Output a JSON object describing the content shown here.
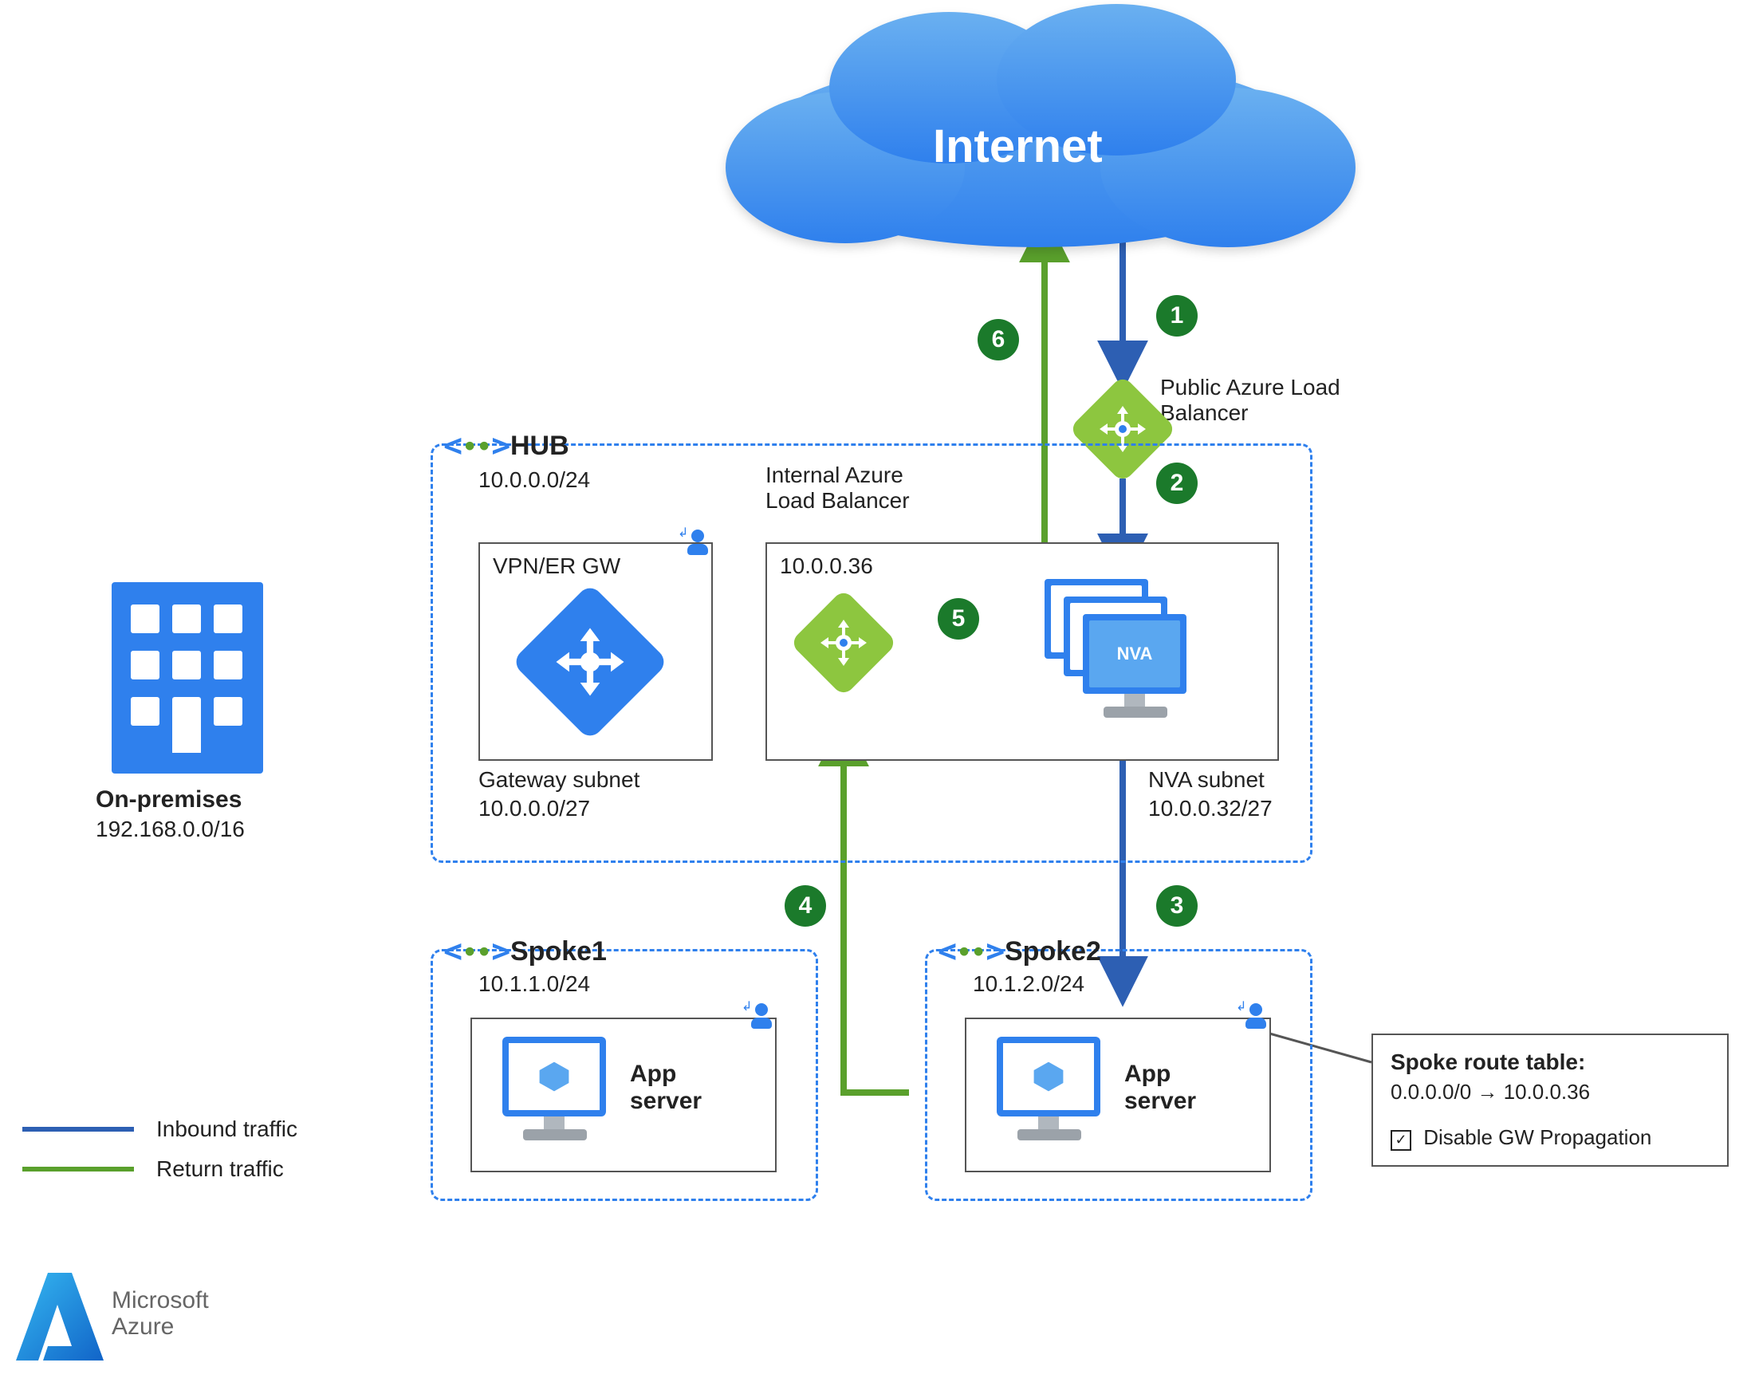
{
  "internet": {
    "label": "Internet"
  },
  "publicLB": {
    "label1": "Public Azure Load",
    "label2": "Balancer"
  },
  "internalLB": {
    "label1": "Internal Azure",
    "label2": "Load Balancer",
    "ip": "10.0.0.36"
  },
  "hub": {
    "title": "HUB",
    "cidr": "10.0.0.0/24",
    "gateway": {
      "title": "VPN/ER GW",
      "subnetLabel": "Gateway subnet",
      "subnetCidr": "10.0.0.0/27"
    },
    "nva": {
      "label": "NVA",
      "subnetLabel": "NVA subnet",
      "subnetCidr": "10.0.0.32/27"
    }
  },
  "spoke1": {
    "title": "Spoke1",
    "cidr": "10.1.1.0/24",
    "app": {
      "label1": "App",
      "label2": "server"
    }
  },
  "spoke2": {
    "title": "Spoke2",
    "cidr": "10.1.2.0/24",
    "app": {
      "label1": "App",
      "label2": "server"
    }
  },
  "onprem": {
    "title": "On-premises",
    "cidr": "192.168.0.0/16"
  },
  "routeTable": {
    "title": "Spoke route table:",
    "rule": "0.0.0.0/0  →   10.0.0.36",
    "checkbox": "Disable GW Propagation"
  },
  "legend": {
    "inbound": "Inbound traffic",
    "return": "Return traffic"
  },
  "steps": {
    "s1": "1",
    "s2": "2",
    "s3": "3",
    "s4": "4",
    "s5": "5",
    "s6": "6"
  },
  "footer": {
    "line1": "Microsoft",
    "line2": "Azure"
  }
}
